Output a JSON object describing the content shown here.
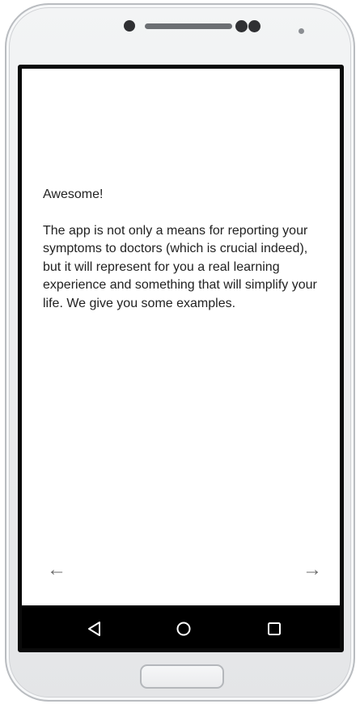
{
  "screen": {
    "paragraphs": [
      "Awesome!",
      "The app is not only a means for reporting your symptoms to doctors (which is crucial indeed), but it will represent for you a real learning experience and something that will simplify your life. We give you some examples."
    ],
    "nav_arrows": {
      "back": "←",
      "forward": "→"
    }
  },
  "system_nav": {
    "buttons": [
      "back",
      "home",
      "recent-apps"
    ]
  },
  "colors": {
    "screen_background": "#ffffff",
    "text": "#222222",
    "arrow": "#6b6b6b",
    "navbar": "#000000",
    "device_body": "#e9eaec"
  }
}
